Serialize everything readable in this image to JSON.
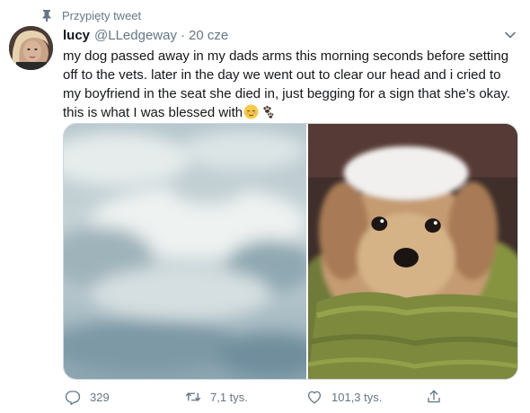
{
  "pinned": {
    "label": "Przypięty tweet",
    "icon": "pin-icon"
  },
  "author": {
    "name": "lucy",
    "handle": "@LLedgeway",
    "separator": "·",
    "time": "20 cze"
  },
  "tweet": {
    "text": "my dog passed away in my dads arms this morning seconds before setting off to the vets. later in the day we went out to clear our head and i cried to my boyfriend in the seat she died in, just begging for a sign that she’s okay. this is what I was blessed with",
    "emojis": [
      "relieved-face-emoji",
      "paw-prints-emoji"
    ]
  },
  "media": [
    {
      "name": "cloud-photo",
      "description_icon": "sky-with-clouds"
    },
    {
      "name": "dog-photo",
      "description_icon": "dog-on-green-blanket"
    }
  ],
  "actions": {
    "reply": {
      "icon": "reply-icon",
      "count": "329"
    },
    "retweet": {
      "icon": "retweet-icon",
      "count": "7,1 tys."
    },
    "like": {
      "icon": "heart-icon",
      "count": "101,3 tys."
    },
    "share": {
      "icon": "share-icon"
    }
  },
  "colors": {
    "secondary_text": "#657786",
    "primary_text": "#14171a",
    "border": "#ccd6dd"
  }
}
